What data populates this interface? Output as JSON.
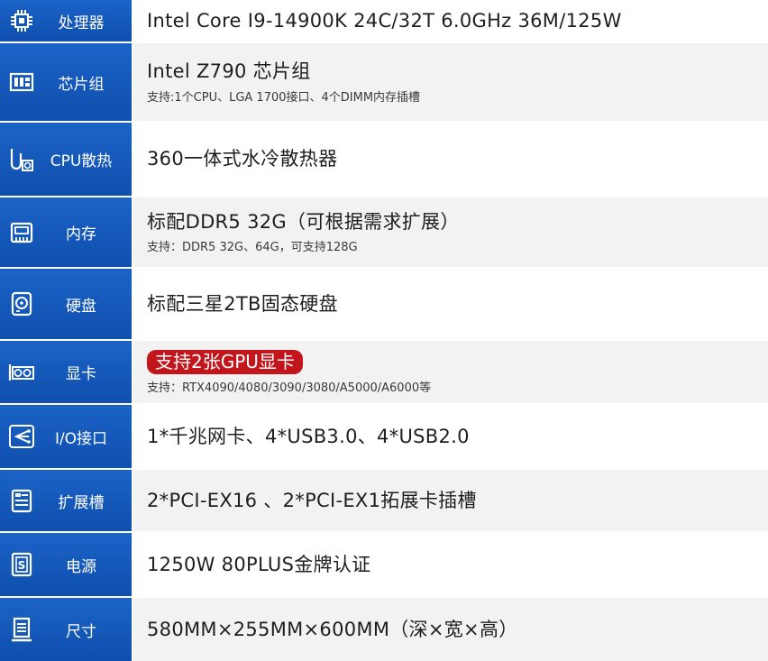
{
  "rows": [
    {
      "label": "处理器",
      "icon": "cpu-chip-icon",
      "main": "Intel Core  I9-14900K 24C/32T 6.0GHz 36M/125W",
      "sub": ""
    },
    {
      "label": "芯片组",
      "icon": "chipset-icon",
      "main": "Intel Z790 芯片组",
      "sub": "支持:1个CPU、LGA 1700接口、4个DIMM内存插槽"
    },
    {
      "label": "CPU散热",
      "icon": "liquid-cooler-icon",
      "main": "360一体式水冷散热器",
      "sub": ""
    },
    {
      "label": "内存",
      "icon": "memory-icon",
      "main": "标配DDR5 32G（可根据需求扩展）",
      "sub": "支持：DDR5 32G、64G，可支持128G"
    },
    {
      "label": "硬盘",
      "icon": "hard-disk-icon",
      "main": "标配三星2TB固态硬盘",
      "sub": ""
    },
    {
      "label": "显卡",
      "icon": "graphics-card-icon",
      "main": "支持2张GPU显卡",
      "sub": "支持：RTX4090/4080/3090/3080/A5000/A6000等"
    },
    {
      "label": "I/O接口",
      "icon": "io-ports-icon",
      "main": "1*千兆网卡、4*USB3.0、4*USB2.0",
      "sub": ""
    },
    {
      "label": "扩展槽",
      "icon": "expansion-slot-icon",
      "main": "2*PCI-EX16 、2*PCI-EX1拓展卡插槽",
      "sub": ""
    },
    {
      "label": "电源",
      "icon": "power-supply-icon",
      "main": "1250W 80PLUS金牌认证",
      "sub": ""
    },
    {
      "label": "尺寸",
      "icon": "dimensions-icon",
      "main": "580MM×255MM×600MM（深×宽×高）",
      "sub": ""
    }
  ],
  "colors": {
    "label_bg": "#1459bb",
    "badge_bg": "#c3161c",
    "row_alt_bg": "#f2f2f2"
  }
}
